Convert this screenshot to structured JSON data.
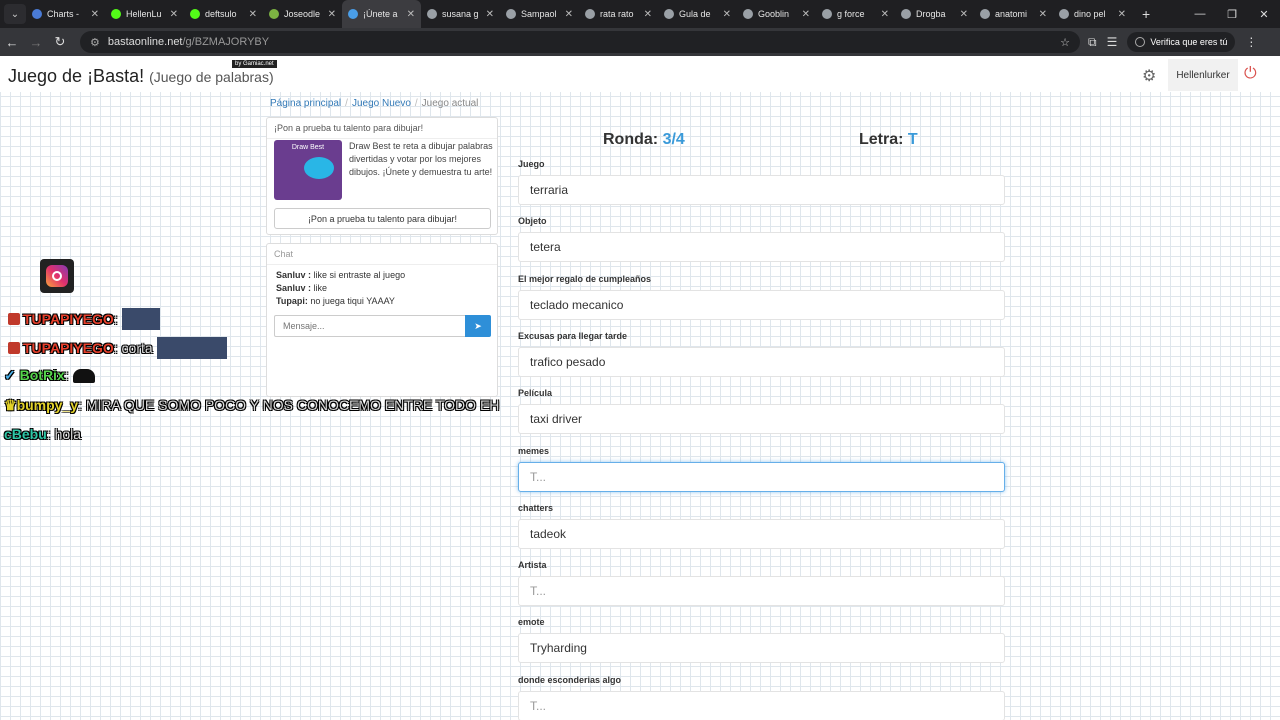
{
  "browser": {
    "tabs": [
      {
        "label": "Charts -",
        "color": "#4a7bd6"
      },
      {
        "label": "HellenLu",
        "color": "#53fc18"
      },
      {
        "label": "deftsulo",
        "color": "#53fc18"
      },
      {
        "label": "Joseodle",
        "color": "#7cb342"
      },
      {
        "label": "¡Únete a",
        "color": "#4a9ee8"
      },
      {
        "label": "susana g",
        "color": "#9aa0a6"
      },
      {
        "label": "Sampaol",
        "color": "#9aa0a6"
      },
      {
        "label": "rata rato",
        "color": "#9aa0a6"
      },
      {
        "label": "Gula de",
        "color": "#9aa0a6"
      },
      {
        "label": "Gooblin",
        "color": "#9aa0a6"
      },
      {
        "label": "g force",
        "color": "#9aa0a6"
      },
      {
        "label": "Drogba",
        "color": "#9aa0a6"
      },
      {
        "label": "anatomi",
        "color": "#9aa0a6"
      },
      {
        "label": "dino pel",
        "color": "#9aa0a6"
      }
    ],
    "url_host": "bastaonline.net",
    "url_path": "/g/BZMAJORYBY",
    "verify_label": "Verifica que eres tú"
  },
  "header": {
    "title": "Juego de ¡Basta!",
    "subtitle": "(Juego de palabras)",
    "badge": "by Gamiac.net",
    "username": "Hellenlurker"
  },
  "breadcrumb": {
    "home": "Página principal",
    "new_game": "Juego Nuevo",
    "current": "Juego actual"
  },
  "promo": {
    "title": "¡Pon a prueba tu talento para dibujar!",
    "thumb_label": "Draw Best",
    "text": "Draw Best te reta a dibujar palabras divertidas y votar por los mejores dibujos. ¡Únete y demuestra tu arte!",
    "button": "¡Pon a prueba tu talento para dibujar!"
  },
  "chat": {
    "title": "Chat",
    "messages": [
      {
        "user": "Sanluv :",
        "text": "like si entraste al juego"
      },
      {
        "user": "Sanluv :",
        "text": "like"
      },
      {
        "user": "Tupapi:",
        "text": "no juega tiqui YAAAY"
      }
    ],
    "placeholder": "Mensaje..."
  },
  "overlay_chat": [
    {
      "user": "TUPAPIYEGO",
      "text": ""
    },
    {
      "user": "TUPAPIYEGO",
      "text": "corta"
    },
    {
      "user": "BotRix",
      "text": ""
    },
    {
      "user": "bumpy_y",
      "text": "MIRA QUE SOMO POCO Y NOS CONOCEMO ENTRE TODO EH"
    },
    {
      "user": "cBebu",
      "text": "hola"
    }
  ],
  "game": {
    "round_label": "Ronda:",
    "round_value": "3/4",
    "letter_label": "Letra:",
    "letter_value": "T",
    "fields": [
      {
        "label": "Juego",
        "value": "terraria",
        "placeholder": "T..."
      },
      {
        "label": "Objeto",
        "value": "tetera",
        "placeholder": "T..."
      },
      {
        "label": "El mejor regalo de cumpleaños",
        "value": "teclado mecanico",
        "placeholder": "T..."
      },
      {
        "label": "Excusas para llegar tarde",
        "value": "trafico pesado",
        "placeholder": "T..."
      },
      {
        "label": "Película",
        "value": "taxi driver",
        "placeholder": "T..."
      },
      {
        "label": "memes",
        "value": "",
        "placeholder": "T..."
      },
      {
        "label": "chatters",
        "value": "tadeok",
        "placeholder": "T..."
      },
      {
        "label": "Artista",
        "value": "",
        "placeholder": "T..."
      },
      {
        "label": "emote",
        "value": "Tryharding",
        "placeholder": "T..."
      },
      {
        "label": "donde esconderias algo",
        "value": "",
        "placeholder": "T..."
      }
    ]
  }
}
